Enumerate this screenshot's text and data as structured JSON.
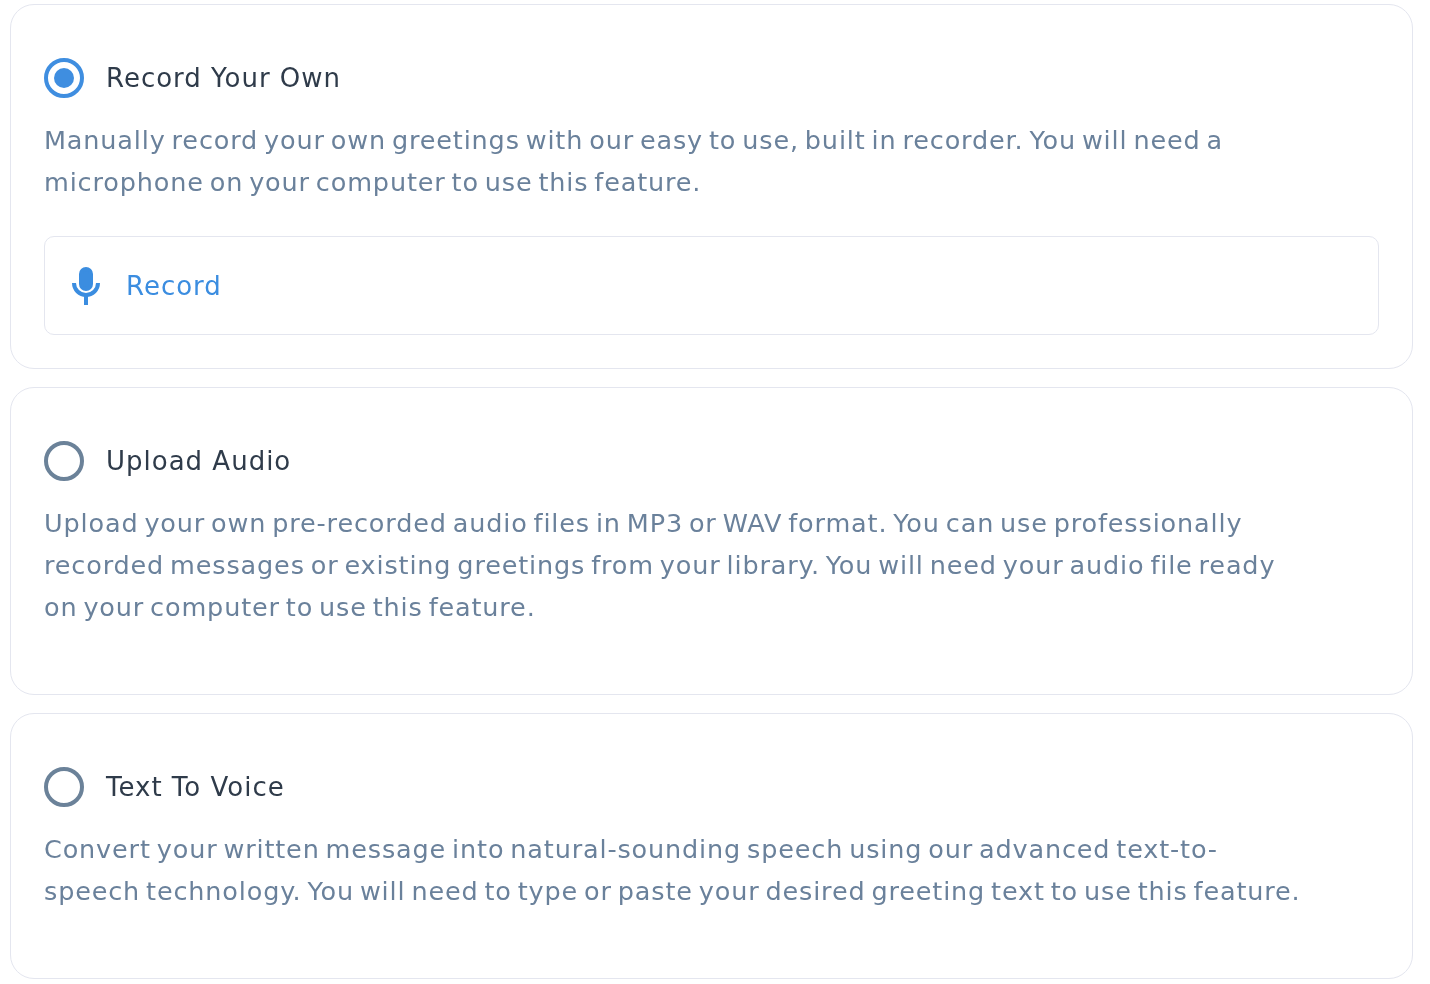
{
  "options": [
    {
      "title": "Record Your Own",
      "description": "Manually record your own greetings with our easy to use, built in recorder. You will need a microphone on your computer to use this feature.",
      "selected": true,
      "action": {
        "label": "Record"
      }
    },
    {
      "title": "Upload Audio",
      "description": "Upload your own pre-recorded audio files in MP3 or WAV format. You can use professionally recorded messages or existing greetings from your library. You will need your audio file ready on your computer to use this feature.",
      "selected": false
    },
    {
      "title": "Text To Voice",
      "description": "Convert your written message into natural-sounding speech using our advanced text-to-speech technology. You will need to type or paste your desired greeting text to use this feature.",
      "selected": false
    }
  ]
}
